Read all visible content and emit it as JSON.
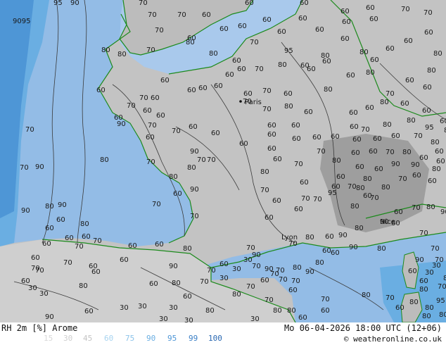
{
  "header": {
    "product": "RH 2m [%] Arome",
    "datetime": "Mo 06-04-2026 18:00 UTC (12+06)",
    "copyright": "© weatheronline.co.uk"
  },
  "legend": [
    {
      "value": "15",
      "color": "#d9d9d9"
    },
    {
      "value": "30",
      "color": "#cfcfcf"
    },
    {
      "value": "45",
      "color": "#c4c4c4"
    },
    {
      "value": "60",
      "color": "#a8d4f0"
    },
    {
      "value": "75",
      "color": "#8cc3ea"
    },
    {
      "value": "90",
      "color": "#6aaee2"
    },
    {
      "value": "95",
      "color": "#4e96d6"
    },
    {
      "value": "99",
      "color": "#3a7fc6"
    },
    {
      "value": "100",
      "color": "#2a68b2"
    }
  ],
  "colors": {
    "land": "#c3c3c3",
    "land_dark": "#9e9e9e",
    "sea": "#93bce6",
    "sea_light": "#a9c9ec",
    "sea_dark": "#5a93d8",
    "coast": "#1c8a1c",
    "contour": "#3a3a3a"
  },
  "places": {
    "paris": "Paris",
    "lyon": "Lyon",
    "nice": "Nice"
  },
  "contour_labels": [
    "95",
    "90",
    "9095",
    "70",
    "70",
    "70",
    "60",
    "60",
    "60",
    "60",
    "60",
    "60",
    "70",
    "70",
    "70",
    "60",
    "60",
    "60",
    "60",
    "60",
    "60",
    "60",
    "60",
    "80",
    "80",
    "70",
    "80",
    "80",
    "70",
    "60",
    "95",
    "80",
    "80",
    "60",
    "60",
    "60",
    "60",
    "60",
    "60",
    "70",
    "60",
    "60",
    "60",
    "60",
    "70",
    "80",
    "60",
    "60",
    "60",
    "60",
    "60",
    "60",
    "80",
    "80",
    "70",
    "60",
    "60",
    "60",
    "60",
    "60",
    "70",
    "60",
    "80",
    "80",
    "70",
    "60",
    "60",
    "60",
    "60",
    "60",
    "60",
    "70",
    "70",
    "80",
    "80",
    "60",
    "60",
    "60",
    "70",
    "70",
    "60",
    "60",
    "60",
    "60",
    "60",
    "70",
    "80",
    "80",
    "95",
    "80",
    "60",
    "90",
    "70",
    "60",
    "60",
    "60",
    "60",
    "60",
    "60",
    "60",
    "60",
    "70",
    "80",
    "60",
    "90",
    "70",
    "70",
    "80",
    "70",
    "80",
    "60",
    "70",
    "70",
    "80",
    "60",
    "60",
    "70",
    "80",
    "60",
    "60",
    "70",
    "90",
    "80",
    "80",
    "60",
    "60",
    "60",
    "60",
    "90",
    "90",
    "80",
    "90",
    "70",
    "60",
    "70",
    "60",
    "70",
    "80",
    "60",
    "80",
    "70",
    "60",
    "60",
    "80",
    "70",
    "60",
    "90",
    "80",
    "90",
    "70",
    "60",
    "60",
    "70",
    "95",
    "80",
    "70",
    "60",
    "70",
    "80",
    "90",
    "80",
    "60",
    "60",
    "60",
    "60",
    "70",
    "60",
    "60",
    "60",
    "80",
    "70",
    "70",
    "80",
    "60",
    "90",
    "80",
    "90",
    "60",
    "70",
    "70",
    "60",
    "70",
    "60",
    "90",
    "90",
    "80",
    "80",
    "60",
    "90",
    "80",
    "90",
    "70",
    "60",
    "70",
    "60",
    "60",
    "70",
    "70",
    "90",
    "60",
    "60",
    "60",
    "70",
    "80",
    "70",
    "80",
    "90",
    "70",
    "70",
    "80",
    "70",
    "60",
    "70",
    "70",
    "60",
    "70",
    "80",
    "80",
    "70",
    "80",
    "70",
    "60",
    "80",
    "80",
    "95",
    "80",
    "80",
    "80",
    "60",
    "70",
    "90",
    "60",
    "60",
    "80",
    "70",
    "60",
    "80",
    "30",
    "30",
    "30",
    "30",
    "30",
    "30",
    "30",
    "30",
    "30",
    "30",
    "30",
    "30",
    "30",
    "60",
    "60",
    "70",
    "60",
    "60",
    "70",
    "60",
    "60",
    "80",
    "80",
    "60",
    "60",
    "80",
    "70",
    "60",
    "80",
    "80",
    "80",
    "80",
    "70",
    "70",
    "70",
    "90",
    "60",
    "70",
    "60",
    "60",
    "95",
    "90",
    "95",
    "80",
    "90",
    "80",
    "60",
    "60",
    "70",
    "80",
    "80",
    "90",
    "90",
    "80"
  ]
}
